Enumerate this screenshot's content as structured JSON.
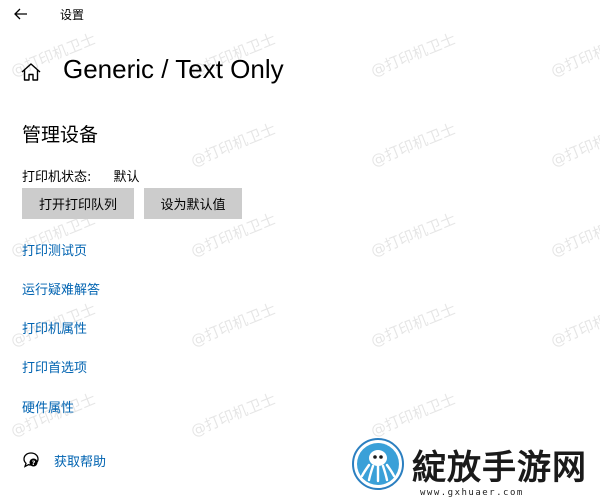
{
  "window": {
    "title": "设置",
    "back_icon": "arrow-left-icon"
  },
  "header": {
    "home_icon": "home-icon",
    "title": "Generic / Text Only"
  },
  "section": {
    "title": "管理设备"
  },
  "status": {
    "label": "打印机状态:",
    "value": "默认"
  },
  "buttons": {
    "open_queue": "打开打印队列",
    "set_default": "设为默认值"
  },
  "links": {
    "test_page": "打印测试页",
    "troubleshoot": "运行疑难解答",
    "printer_properties": "打印机属性",
    "printing_preferences": "打印首选项",
    "hardware_properties": "硬件属性"
  },
  "help": {
    "icon": "chat-help-icon",
    "label": "获取帮助"
  },
  "watermark": {
    "text": "@打印机卫士"
  },
  "brand": {
    "name": "綻放手游网",
    "url": "www.gxhuaer.com"
  },
  "colors": {
    "link": "#0063b1",
    "button_bg": "#cccccc",
    "background": "#ffffff"
  }
}
